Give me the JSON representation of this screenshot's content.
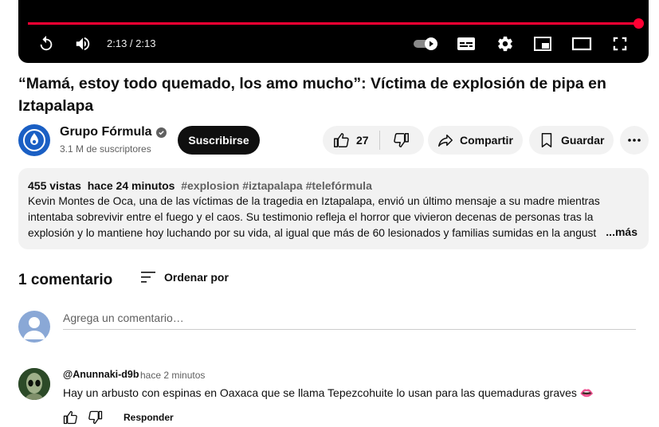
{
  "player": {
    "time": "2:13 / 2:13",
    "progress": 1.0,
    "accent_color": "#ff0033",
    "controls": [
      "replay-icon",
      "volume-icon",
      "autoplay-toggle-icon",
      "subtitles-icon",
      "settings-icon",
      "miniplayer-icon",
      "theater-icon",
      "fullscreen-icon"
    ]
  },
  "video": {
    "title": "“Mamá, estoy todo quemado, los amo mucho”: Víctima de explosión de pipa en Iztapalapa"
  },
  "channel": {
    "name": "Grupo Fórmula",
    "subscribers": "3.1 M de suscriptores",
    "subscribe_label": "Suscribirse"
  },
  "actions": {
    "likes": "27",
    "share_label": "Compartir",
    "save_label": "Guardar"
  },
  "description": {
    "views": "455 vistas",
    "age": "hace 24 minutos",
    "tags": "#explosion #iztapalapa #telefórmula",
    "text": "Kevin Montes de Oca, una de las víctimas de la tragedia en Iztapalapa, envió un último mensaje a su madre mientras intentaba sobrevivir entre el fuego y el caos. Su testimonio refleja el horror que vivieron decenas de personas tras la explosión y lo mantiene hoy luchando por su vida, al igual que más de 60 lesionados y familias sumidas en la angust",
    "more_label": "...más"
  },
  "comments": {
    "count_label": "1 comentario",
    "sort_label": "Ordenar por",
    "input_placeholder": "Agrega un comentario…",
    "items": [
      {
        "author": "@Anunnaki-d9b",
        "time": "hace 2 minutos",
        "text": "Hay un arbusto con espinas en Oaxaca que se llama Tepezcohuite lo usan para las quemaduras graves 👄",
        "reply_label": "Responder"
      }
    ]
  }
}
